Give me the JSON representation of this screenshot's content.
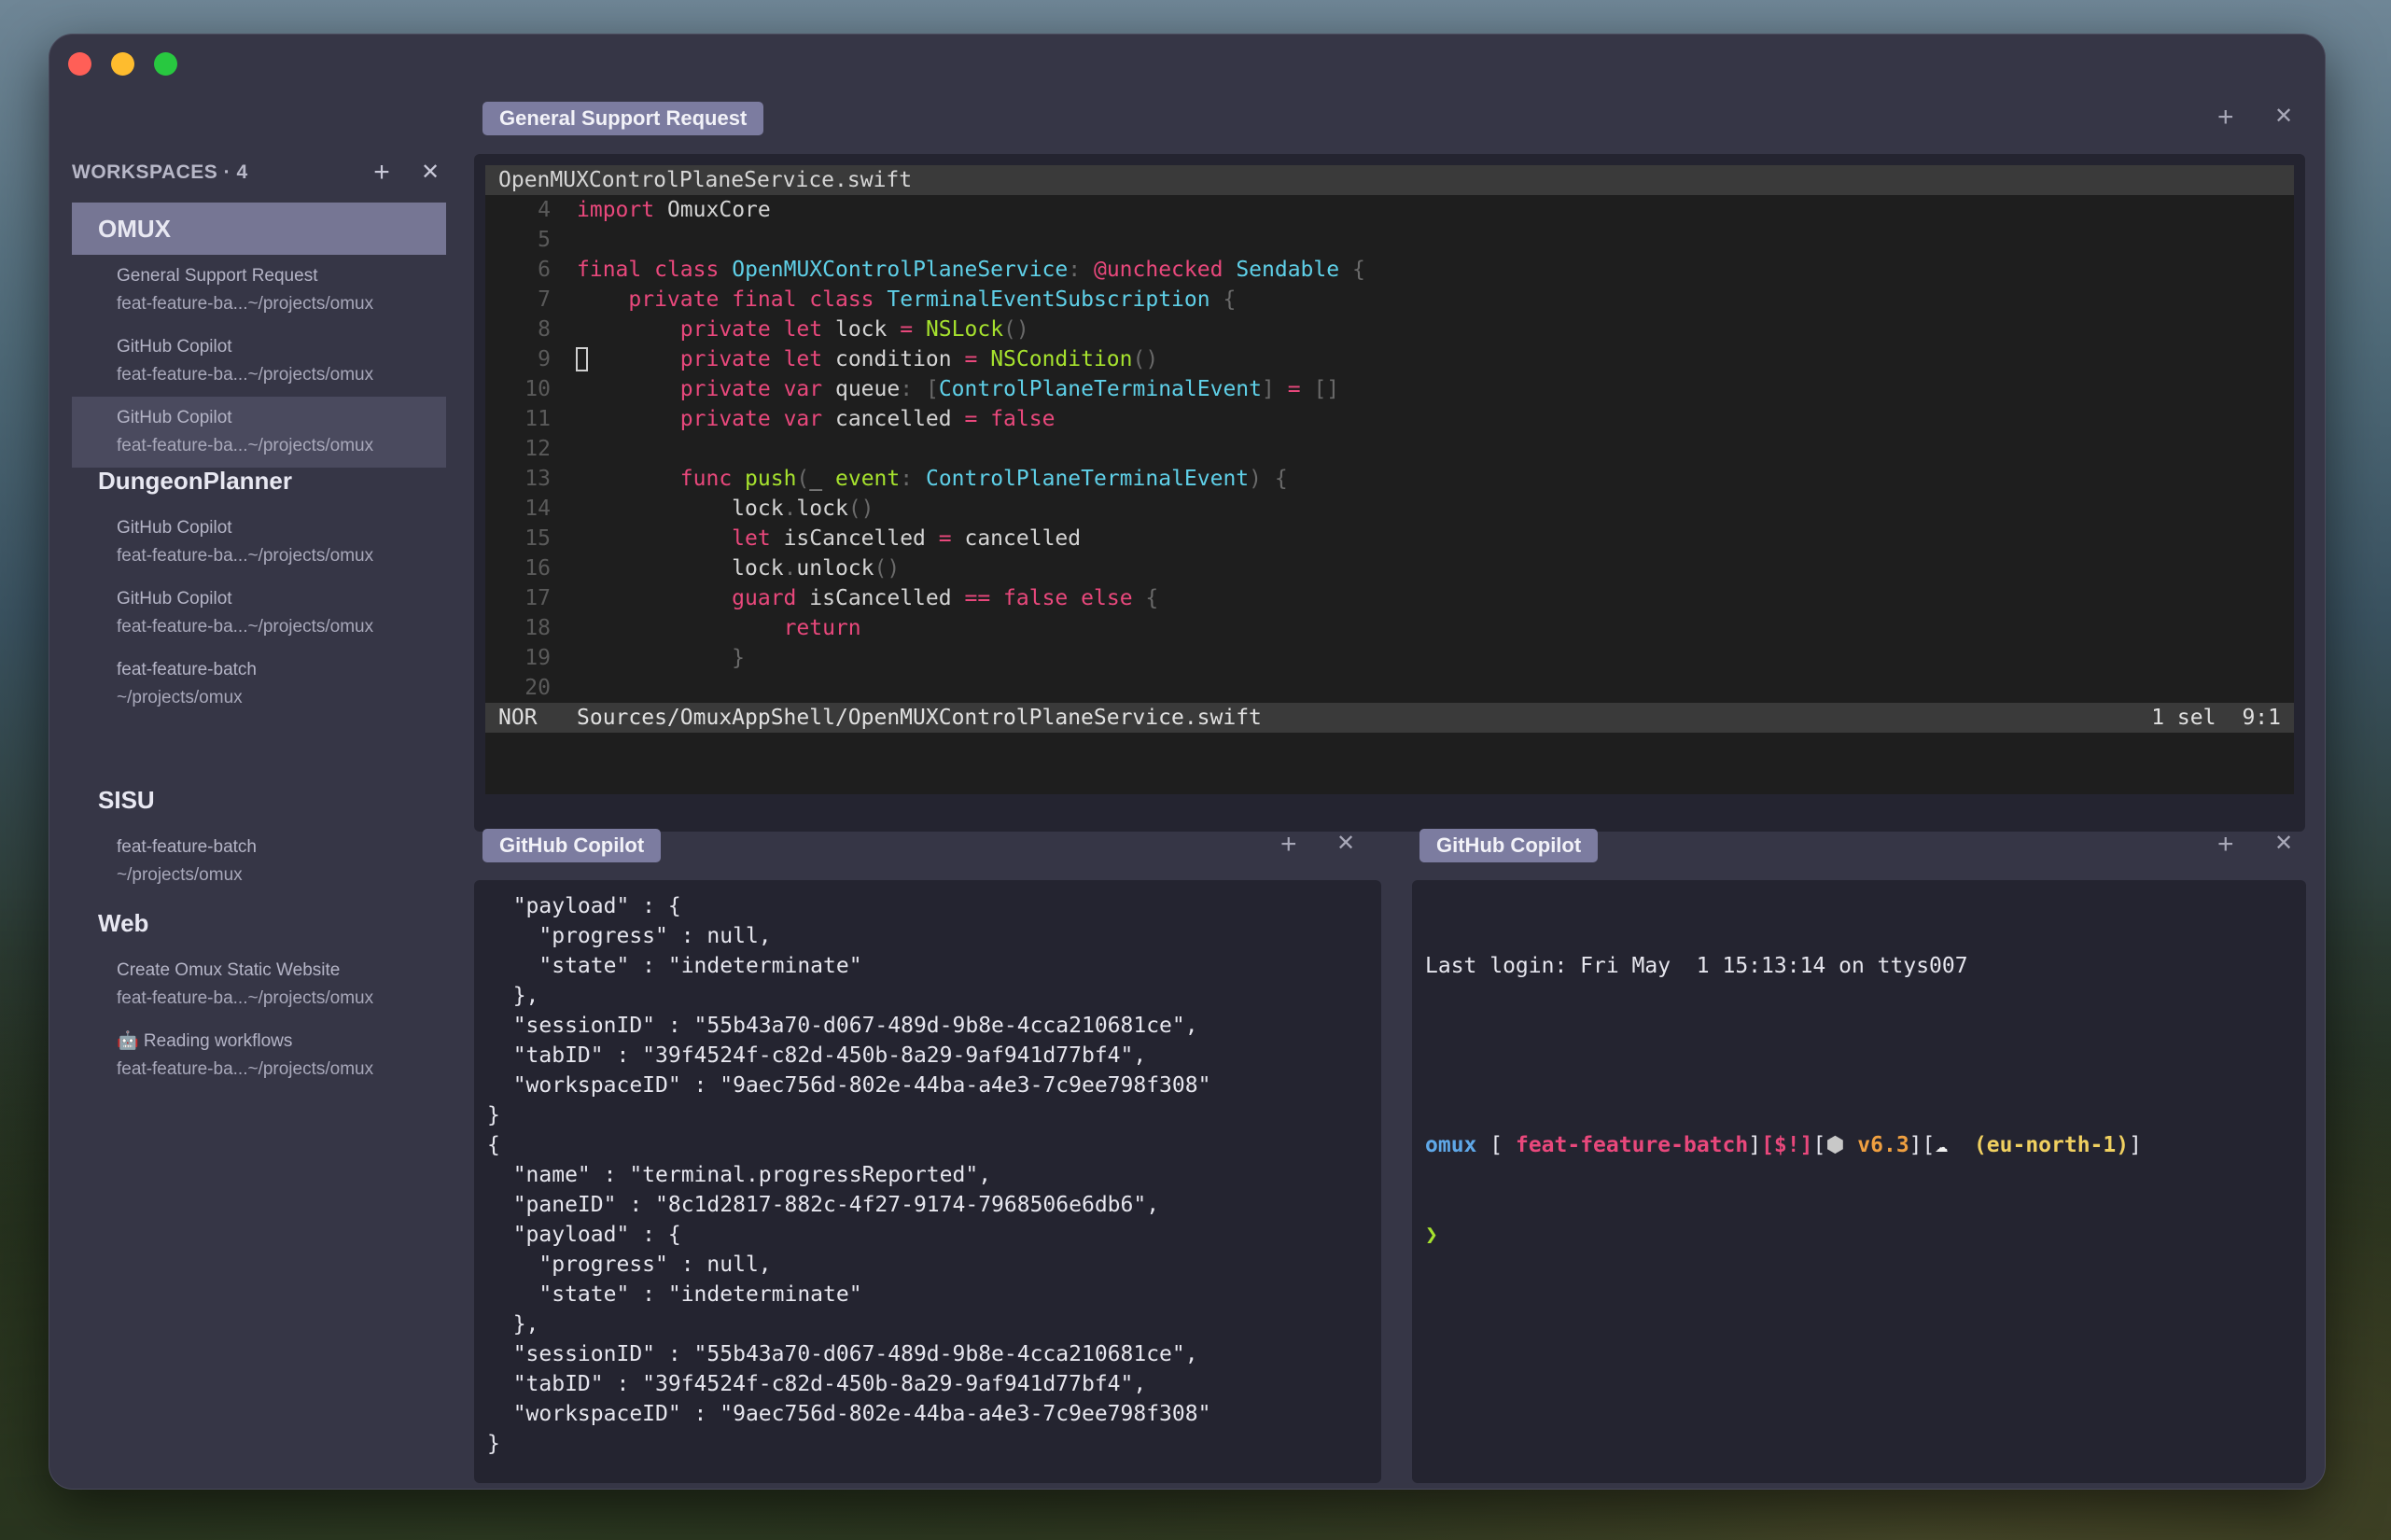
{
  "sidebar": {
    "title": "WORKSPACES · 4",
    "add_icon": "+",
    "close_icon": "✕",
    "workspaces": [
      {
        "name": "OMUX",
        "tabs": [
          {
            "title": "General Support Request",
            "subtitle": "feat-feature-ba...~/projects/omux"
          },
          {
            "title": "GitHub Copilot",
            "subtitle": "feat-feature-ba...~/projects/omux"
          },
          {
            "title": "GitHub Copilot",
            "subtitle": "feat-feature-ba...~/projects/omux"
          }
        ]
      },
      {
        "name": "DungeonPlanner",
        "tabs": [
          {
            "title": "GitHub Copilot",
            "subtitle": "feat-feature-ba...~/projects/omux"
          },
          {
            "title": "GitHub Copilot",
            "subtitle": "feat-feature-ba...~/projects/omux"
          },
          {
            "title": "feat-feature-batch",
            "subtitle": "~/projects/omux"
          }
        ]
      },
      {
        "name": "SISU",
        "tabs": [
          {
            "title": "feat-feature-batch",
            "subtitle": "~/projects/omux"
          }
        ]
      },
      {
        "name": "Web",
        "tabs": [
          {
            "title": "Create Omux Static Website",
            "subtitle": "feat-feature-ba...~/projects/omux"
          },
          {
            "title": "🤖 Reading workflows",
            "subtitle": "feat-feature-ba...~/projects/omux"
          }
        ]
      }
    ]
  },
  "top_pane": {
    "label": "General Support Request",
    "editor": {
      "filename": "OpenMUXControlPlaneService.swift",
      "lines": [
        {
          "n": "4",
          "text": "import OmuxCore"
        },
        {
          "n": "5",
          "text": ""
        },
        {
          "n": "6",
          "text": "final class OpenMUXControlPlaneService: @unchecked Sendable {"
        },
        {
          "n": "7",
          "text": "    private final class TerminalEventSubscription {"
        },
        {
          "n": "8",
          "text": "        private let lock = NSLock()"
        },
        {
          "n": "9",
          "text": "        private let condition = NSCondition()"
        },
        {
          "n": "10",
          "text": "        private var queue: [ControlPlaneTerminalEvent] = []"
        },
        {
          "n": "11",
          "text": "        private var cancelled = false"
        },
        {
          "n": "12",
          "text": ""
        },
        {
          "n": "13",
          "text": "        func push(_ event: ControlPlaneTerminalEvent) {"
        },
        {
          "n": "14",
          "text": "            lock.lock()"
        },
        {
          "n": "15",
          "text": "            let isCancelled = cancelled"
        },
        {
          "n": "16",
          "text": "            lock.unlock()"
        },
        {
          "n": "17",
          "text": "            guard isCancelled == false else {"
        },
        {
          "n": "18",
          "text": "                return"
        },
        {
          "n": "19",
          "text": "            }"
        },
        {
          "n": "20",
          "text": ""
        }
      ],
      "status": {
        "mode": "NOR",
        "path": "Sources/OmuxAppShell/OpenMUXControlPlaneService.swift",
        "selection": "1 sel",
        "position": "9:1"
      }
    }
  },
  "left_pane": {
    "label": "GitHub Copilot",
    "output": [
      "  \"payload\" : {",
      "    \"progress\" : null,",
      "    \"state\" : \"indeterminate\"",
      "  },",
      "  \"sessionID\" : \"55b43a70-d067-489d-9b8e-4cca210681ce\",",
      "  \"tabID\" : \"39f4524f-c82d-450b-8a29-9af941d77bf4\",",
      "  \"workspaceID\" : \"9aec756d-802e-44ba-a4e3-7c9ee798f308\"",
      "}",
      "{",
      "  \"name\" : \"terminal.progressReported\",",
      "  \"paneID\" : \"8c1d2817-882c-4f27-9174-7968506e6db6\",",
      "  \"payload\" : {",
      "    \"progress\" : null,",
      "    \"state\" : \"indeterminate\"",
      "  },",
      "  \"sessionID\" : \"55b43a70-d067-489d-9b8e-4cca210681ce\",",
      "  \"tabID\" : \"39f4524f-c82d-450b-8a29-9af941d77bf4\",",
      "  \"workspaceID\" : \"9aec756d-802e-44ba-a4e3-7c9ee798f308\"",
      "}"
    ]
  },
  "right_pane": {
    "label": "GitHub Copilot",
    "last_login": "Last login: Fri May  1 15:13:14 on ttys007",
    "prompt": {
      "dir": "omux",
      "branch_glyph": "",
      "branch": "feat-feature-batch",
      "git_status": "[$!]",
      "node_icon": "⬢",
      "node_version": "v6.3",
      "cloud_icon": "☁",
      "region": "(eu-north-1)",
      "symbol": "❯"
    }
  },
  "colors": {
    "window_bg": "#363646",
    "accent_label": "#7c7ca0",
    "keyword": "#e9487c",
    "type": "#5fd0e8",
    "function": "#a6e22e"
  }
}
